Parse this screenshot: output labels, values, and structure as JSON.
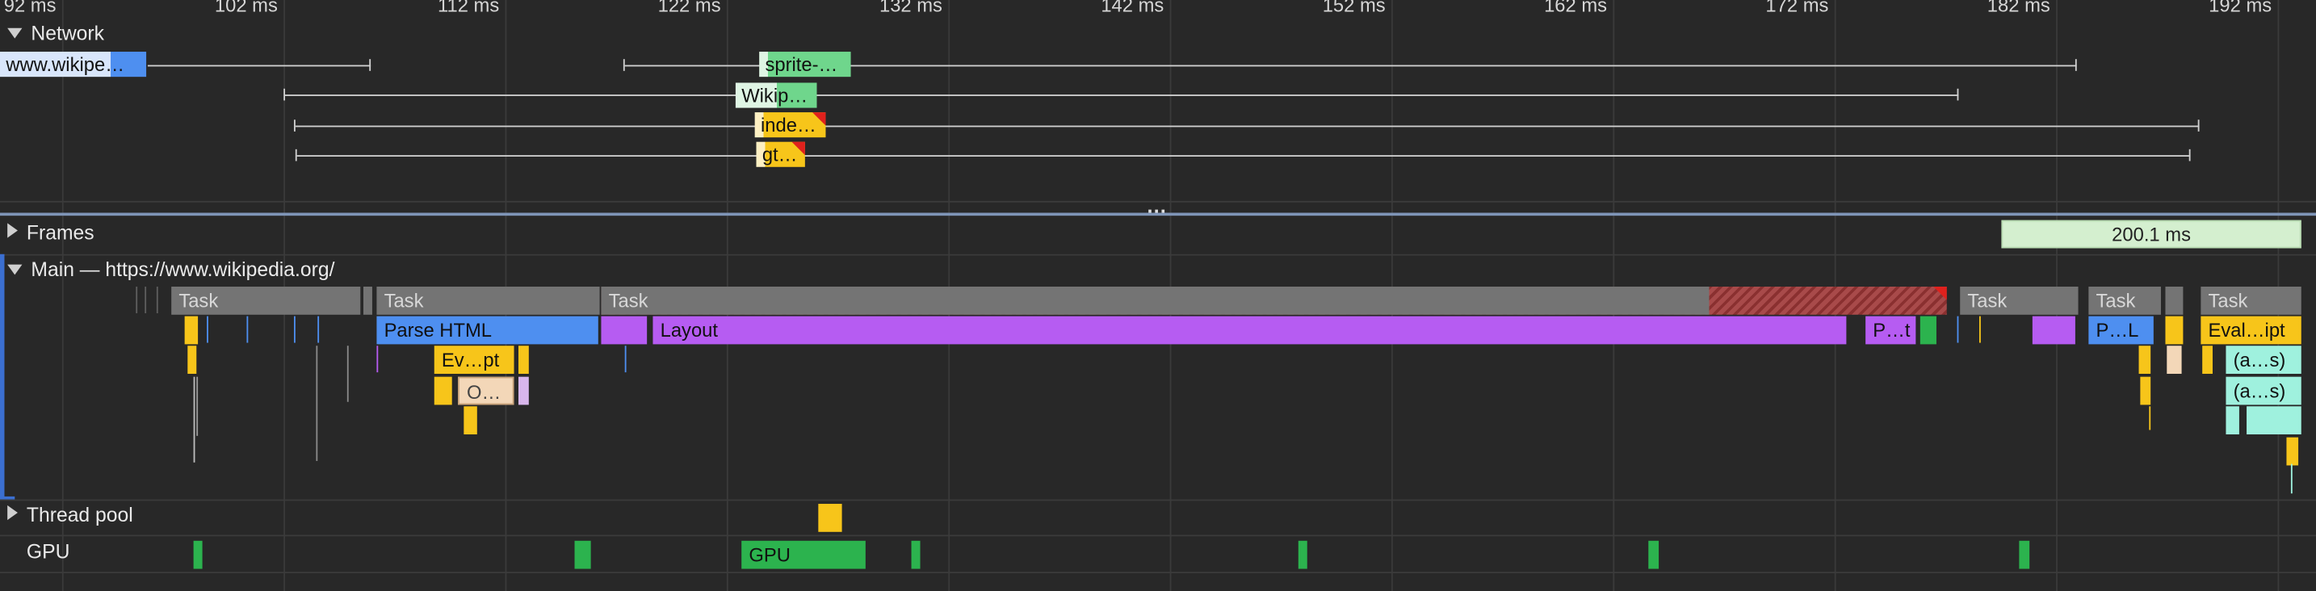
{
  "timeline": {
    "ticks": [
      "92 ms",
      "102 ms",
      "112 ms",
      "122 ms",
      "132 ms",
      "142 ms",
      "152 ms",
      "162 ms",
      "172 ms",
      "182 ms",
      "192 ms"
    ]
  },
  "network": {
    "label": "Network",
    "requests": [
      {
        "label": "www.wikipe…",
        "color": "#4e8ff0"
      },
      {
        "label": "sprite-…",
        "color": "#6fd68c"
      },
      {
        "label": "Wikip…",
        "color": "#6fd68c"
      },
      {
        "label": "inde…",
        "color": "#f7c51a"
      },
      {
        "label": "gt…",
        "color": "#f7c51a"
      }
    ]
  },
  "splitter": {
    "glyph": "…"
  },
  "frames": {
    "label": "Frames",
    "duration": "200.1 ms"
  },
  "main": {
    "label": "Main — https://www.wikipedia.org/",
    "tasks": [
      "Task",
      "Task",
      "Task",
      "Task",
      "Task",
      "Task"
    ],
    "events": {
      "parse_html": "Parse HTML",
      "layout": "Layout",
      "p_t": "P…t",
      "p_l": "P…L",
      "eval_script": "Eval…ipt",
      "ev_pt": "Ev…pt",
      "o": "O…",
      "anon_1": "(a…s)",
      "anon_2": "(a…s)"
    }
  },
  "thread_pool": {
    "label": "Thread pool"
  },
  "gpu": {
    "label": "GPU",
    "block_label": "GPU"
  },
  "colors": {
    "background": "#282828",
    "task": "#747474",
    "scripting": "#f7c51a",
    "rendering": "#b65cf2",
    "loading": "#4e8ff0",
    "painting": "#2cb34e",
    "long_task_warning": "#e0211d"
  }
}
